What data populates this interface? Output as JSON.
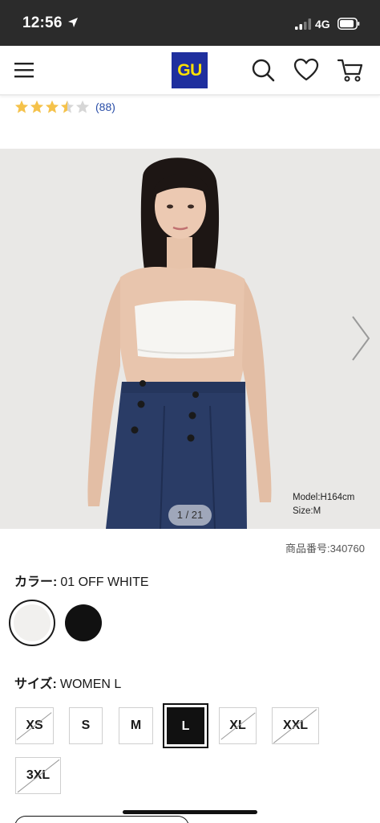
{
  "status_bar": {
    "time": "12:56",
    "network": "4G"
  },
  "header": {
    "logo_text": "GU"
  },
  "rating": {
    "stars": 3.5,
    "max": 5,
    "count_text": "(88)"
  },
  "gallery": {
    "model_height": "Model:H164cm",
    "model_size": "Size:M",
    "pager": "1 / 21"
  },
  "product": {
    "number_text": "商品番号:340760"
  },
  "color": {
    "label": "カラー:",
    "value": "01 OFF WHITE",
    "swatches": [
      {
        "name": "off-white",
        "hex": "#f1f0ee",
        "selected": true
      },
      {
        "name": "black",
        "hex": "#111111",
        "selected": false
      }
    ]
  },
  "size": {
    "label": "サイズ:",
    "value": "WOMEN L",
    "options": [
      {
        "label": "XS",
        "available": false,
        "selected": false
      },
      {
        "label": "S",
        "available": true,
        "selected": false
      },
      {
        "label": "M",
        "available": true,
        "selected": false
      },
      {
        "label": "L",
        "available": true,
        "selected": true
      },
      {
        "label": "XL",
        "available": false,
        "selected": false
      },
      {
        "label": "XXL",
        "available": false,
        "selected": false
      },
      {
        "label": "3XL",
        "available": false,
        "selected": false
      }
    ]
  },
  "colors": {
    "status_bar": "#2b2b2b",
    "logo_bg": "#1f2f9e",
    "logo_text": "#ffe100",
    "star": "#f5c24a",
    "link": "#2a4ea8"
  }
}
